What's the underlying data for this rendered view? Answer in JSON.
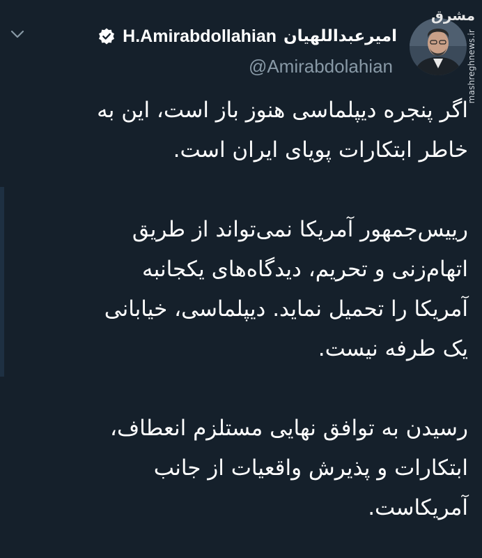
{
  "author": {
    "display_name_fa": "امیرعبداللهیان",
    "display_name_en": "H.Amirabdollahian",
    "handle": "@Amirabdolahian",
    "verified": true
  },
  "icons": {
    "more": "chevron-down-icon",
    "verified": "verified-badge-icon",
    "avatar": "profile-photo"
  },
  "watermark": {
    "logo": "مشرق",
    "url": "mashreghnews.ir"
  },
  "tweet": {
    "paragraphs": [
      [
        "اگر پنجره دیپلماسی هنوز باز است، این به",
        "خاطر ابتکارات پویای ایران است."
      ],
      [
        "رییس‌جمهور آمریکا نمی‌تواند از طریق",
        "اتهام‌زنی و تحریم، دیدگاه‌های یکجانبه",
        "آمریکا را تحمیل نماید. دیپلماسی، خیابانی",
        "یک طرفه نیست."
      ],
      [
        "رسیدن به توافق نهایی مستلزم انعطاف،",
        "ابتکارات و پذیرش واقعیات از جانب",
        "آمریکاست."
      ]
    ]
  },
  "colors": {
    "background": "#15202b",
    "text": "#ffffff",
    "muted": "#8899a6"
  }
}
